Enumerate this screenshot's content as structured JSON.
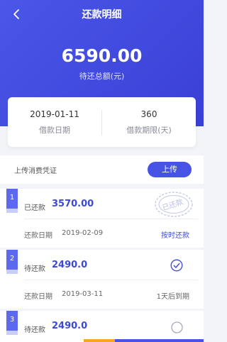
{
  "header": {
    "title": "还款明细",
    "total_amount": "6590.00",
    "total_label": "待还总额(元)"
  },
  "info": {
    "loan_date": "2019-01-11",
    "loan_date_label": "借款日期",
    "term": "360",
    "term_label": "借款期限(天)"
  },
  "upload": {
    "label": "上传消费凭证",
    "button": "上传"
  },
  "installments": [
    {
      "index": "1",
      "status": "已还款",
      "amount": "3570.00",
      "date_label": "还款日期",
      "date": "2019-02-09",
      "right_status": "按时还款",
      "stamp": "已还款"
    },
    {
      "index": "2",
      "status": "待还款",
      "amount": "2490.0",
      "date_label": "还款日期",
      "date": "2019-03-11",
      "right_status": "1天后到期"
    },
    {
      "index": "3",
      "status": "待还款",
      "amount": "2490.0"
    }
  ],
  "colors": {
    "primary": "#4653e4",
    "header_gradient_start": "#4a57e8",
    "header_gradient_end": "#3a3fd6",
    "amount_blue": "#3c49d6",
    "orange_accent": "#f5a623"
  }
}
